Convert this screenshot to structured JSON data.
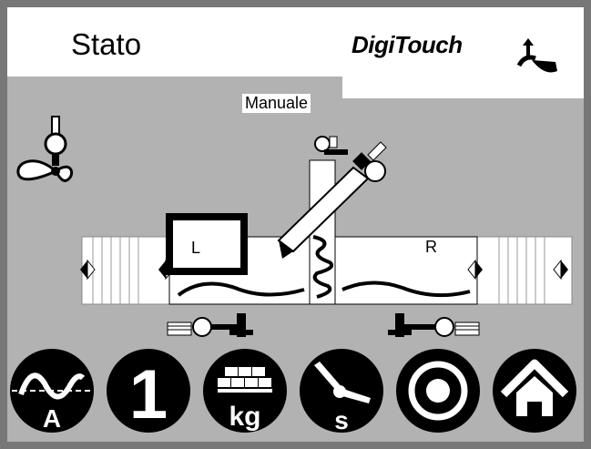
{
  "header": {
    "title": "Stato",
    "brand": "DigiTouch"
  },
  "status": {
    "mode": "Manuale"
  },
  "sides": {
    "left": "L",
    "right": "R",
    "selected": "L"
  },
  "toolbar": {
    "buttons": [
      {
        "icon": "sine-wave-icon",
        "label": "A"
      },
      {
        "icon": "number-one-icon",
        "label": "1"
      },
      {
        "icon": "weight-bricks-icon",
        "label": "kg"
      },
      {
        "icon": "clock-hand-icon",
        "label": "s"
      },
      {
        "icon": "target-icon"
      },
      {
        "icon": "home-icon"
      }
    ]
  },
  "colors": {
    "background": "#b2b2b2",
    "border": "#777777",
    "panel": "#ffffff",
    "ink": "#000000"
  }
}
